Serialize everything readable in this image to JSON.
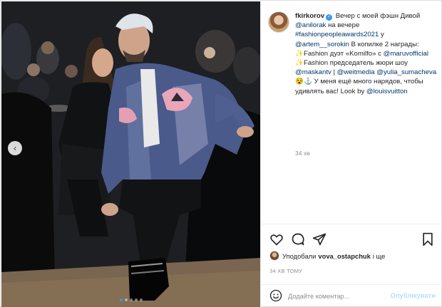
{
  "post": {
    "username": "fkirkorov",
    "caption_parts": [
      {
        "text": "Вечер с моей фэшн Дивой ",
        "type": "text"
      },
      {
        "text": "@anilorak",
        "type": "link"
      },
      {
        "text": " на вечере ",
        "type": "text"
      },
      {
        "text": "#fashionpeopleawards2021",
        "type": "link"
      },
      {
        "text": " у ",
        "type": "text"
      },
      {
        "text": "@artem__sorokin",
        "type": "link"
      },
      {
        "text": " В копилке 2 награды: ",
        "type": "text"
      },
      {
        "text": "✨",
        "type": "spark"
      },
      {
        "text": "Fashion дуэт «Komilfo» с ",
        "type": "text"
      },
      {
        "text": "@maruvofficial",
        "type": "link"
      },
      {
        "text": " ",
        "type": "text"
      },
      {
        "text": "✨",
        "type": "spark"
      },
      {
        "text": "Fashion председатель жюри шоу ",
        "type": "text"
      },
      {
        "text": "@maskantv",
        "type": "link"
      },
      {
        "text": " | ",
        "type": "text"
      },
      {
        "text": "@weitmedia",
        "type": "link"
      },
      {
        "text": " ",
        "type": "text"
      },
      {
        "text": "@yulia_sumacheva",
        "type": "link"
      },
      {
        "text": " 😵⚓ У меня ещё много нарядов, чтобы удивлять вас! Look by ",
        "type": "text"
      },
      {
        "text": "@louisvuitton",
        "type": "link"
      }
    ],
    "caption_time": "34 хв",
    "liked_by_prefix": "Уподобали",
    "liked_by_user": "vova_ostapchuk",
    "liked_by_suffix": "і ще",
    "post_time": "34 ХВ ТОМУ",
    "comment_placeholder": "Додайте коментар...",
    "post_button": "Опублікувати"
  },
  "carousel": {
    "total": 5,
    "active_index": 0,
    "prev_glyph": "‹"
  },
  "icons": {
    "like": "heart-icon",
    "comment": "comment-icon",
    "share": "paper-plane-icon",
    "save": "bookmark-icon",
    "emoji": "smiley-icon",
    "verified": "verified-badge-icon"
  },
  "colors": {
    "link": "#00376b",
    "muted": "#8e8e8e",
    "verified": "#3897f0",
    "post_button": "#b2dffc"
  }
}
